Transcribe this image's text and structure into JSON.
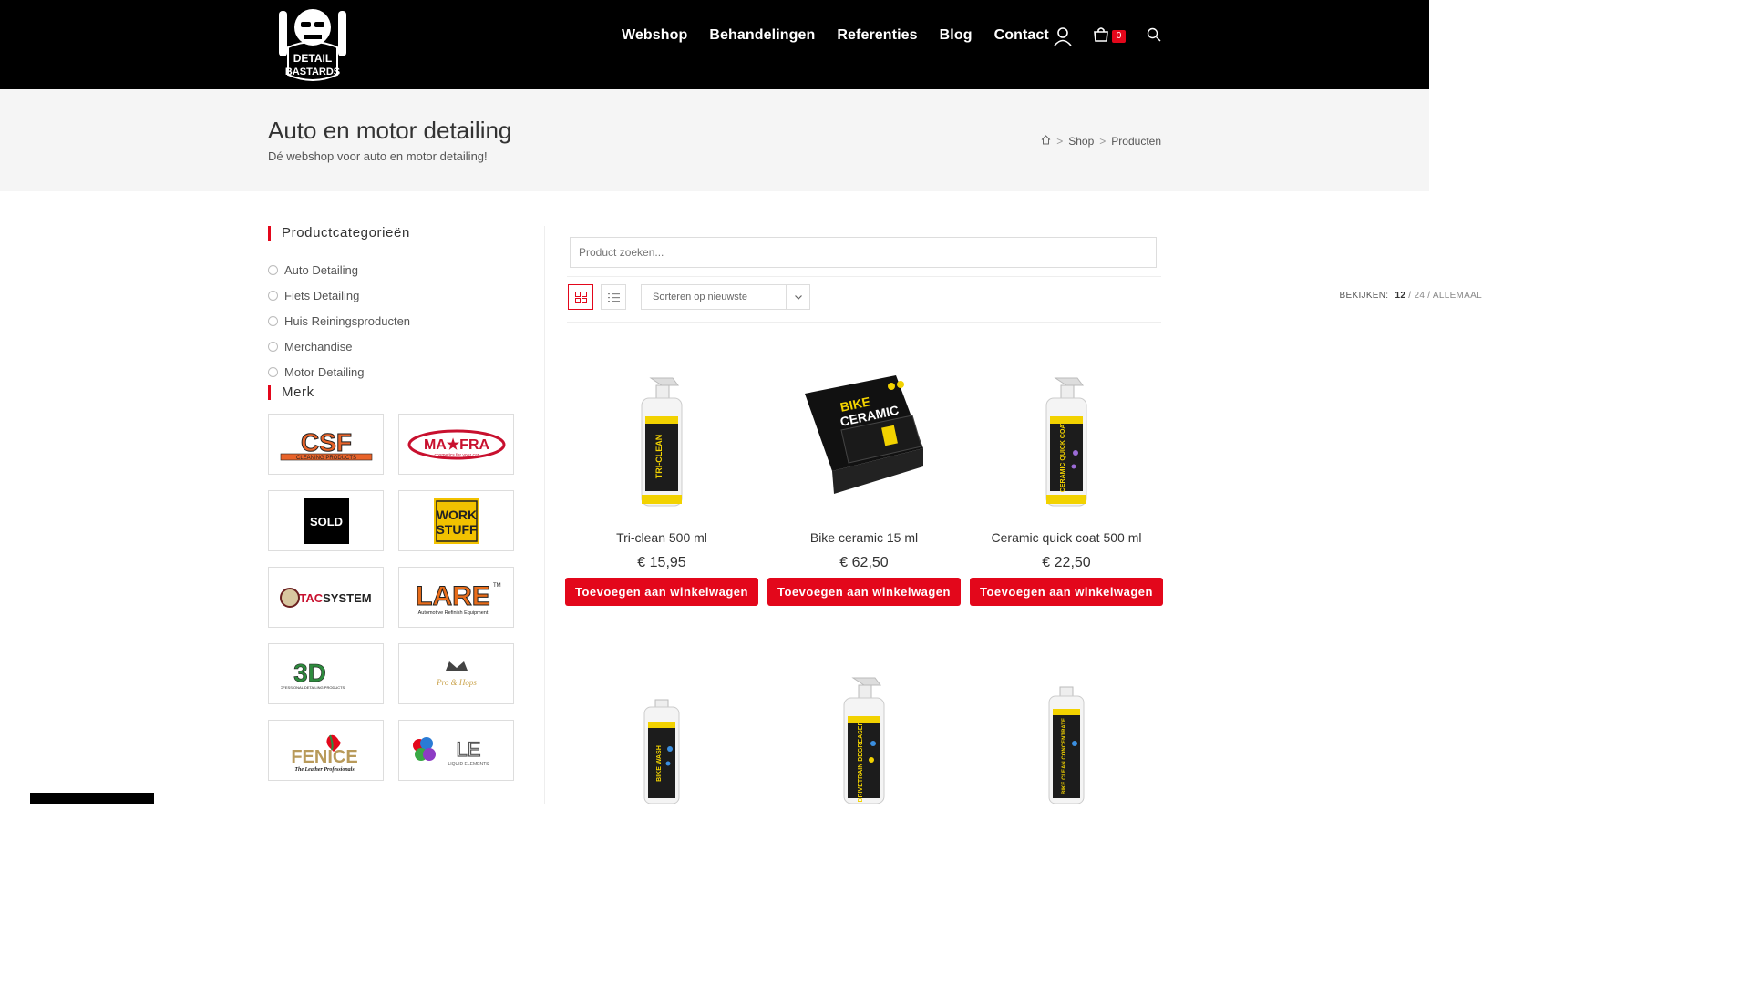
{
  "header": {
    "logo_alt": "Detail Bastards",
    "nav": [
      "Webshop",
      "Behandelingen",
      "Referenties",
      "Blog",
      "Contact"
    ],
    "cart_count": "0",
    "accent_color": "#e3071b"
  },
  "page": {
    "title": "Auto en motor detailing",
    "subtitle": "Dé webshop voor auto en motor detailing!",
    "breadcrumb": [
      "Shop",
      "Producten"
    ]
  },
  "sidebar": {
    "categories_title": "Productcategorieën",
    "categories": [
      "Auto Detailing",
      "Fiets Detailing",
      "Huis Reiningsproducten",
      "Merchandise",
      "Motor Detailing"
    ],
    "brands_title": "Merk",
    "brands": [
      "CSF Cleaning Products",
      "MA-FRA",
      "SOLD",
      "Work Stuff",
      "TACSYSTEM",
      "LARE",
      "3D",
      "Pro & Hops",
      "FENICE",
      "Liquid Elements"
    ]
  },
  "shop": {
    "search_placeholder": "Product zoeken...",
    "sort_label": "Sorteren op nieuwste",
    "perpage_label": "BEKIJKEN:",
    "perpage_current": "12",
    "perpage_options": [
      "24",
      "ALLEMAAL"
    ],
    "add_to_cart": "Toevoegen aan winkelwagen",
    "products": [
      {
        "name": "Tri-clean 500 ml",
        "price": "€ 15,95"
      },
      {
        "name": "Bike ceramic 15 ml",
        "price": "€ 62,50"
      },
      {
        "name": "Ceramic quick coat 500 ml",
        "price": "€ 22,50"
      },
      {
        "name": "",
        "price": ""
      },
      {
        "name": "",
        "price": ""
      },
      {
        "name": "",
        "price": ""
      }
    ]
  }
}
